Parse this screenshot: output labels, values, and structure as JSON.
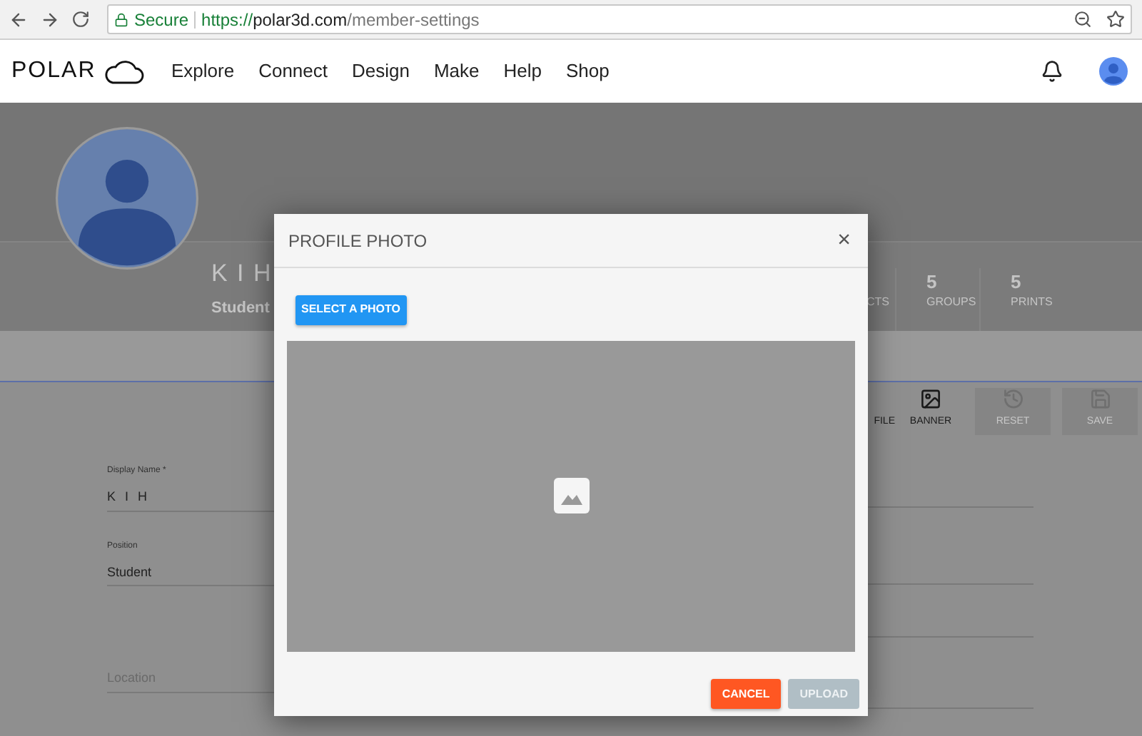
{
  "browser": {
    "secure": "Secure",
    "scheme": "https://",
    "host": "polar3d.com",
    "path": "/member-settings"
  },
  "nav": {
    "logo": "POLAR",
    "items": [
      "Explore",
      "Connect",
      "Design",
      "Make",
      "Help",
      "Shop"
    ]
  },
  "profile": {
    "name": "K I H",
    "position": "Student",
    "stats": [
      {
        "label": "CTS"
      },
      {
        "value": "5",
        "label": "GROUPS"
      },
      {
        "value": "5",
        "label": "PRINTS"
      }
    ]
  },
  "actions": [
    {
      "label": "FILE",
      "kind": "text",
      "disabled": false
    },
    {
      "label": "BANNER",
      "kind": "banner",
      "disabled": false
    },
    {
      "label": "RESET",
      "kind": "reset",
      "disabled": true
    },
    {
      "label": "SAVE",
      "kind": "save",
      "disabled": true
    }
  ],
  "form": {
    "fields": [
      {
        "label": "Display Name *",
        "value": "K I H"
      },
      {
        "label": "Position",
        "value": "Student"
      },
      {
        "placeholder": "Location"
      }
    ]
  },
  "dialog": {
    "title": "PROFILE PHOTO",
    "close": "×",
    "select_button": "SELECT A PHOTO",
    "buttons": [
      {
        "label": "CANCEL",
        "kind": "cancel",
        "disabled": false
      },
      {
        "label": "UPLOAD",
        "kind": "upload",
        "disabled": true
      }
    ]
  }
}
